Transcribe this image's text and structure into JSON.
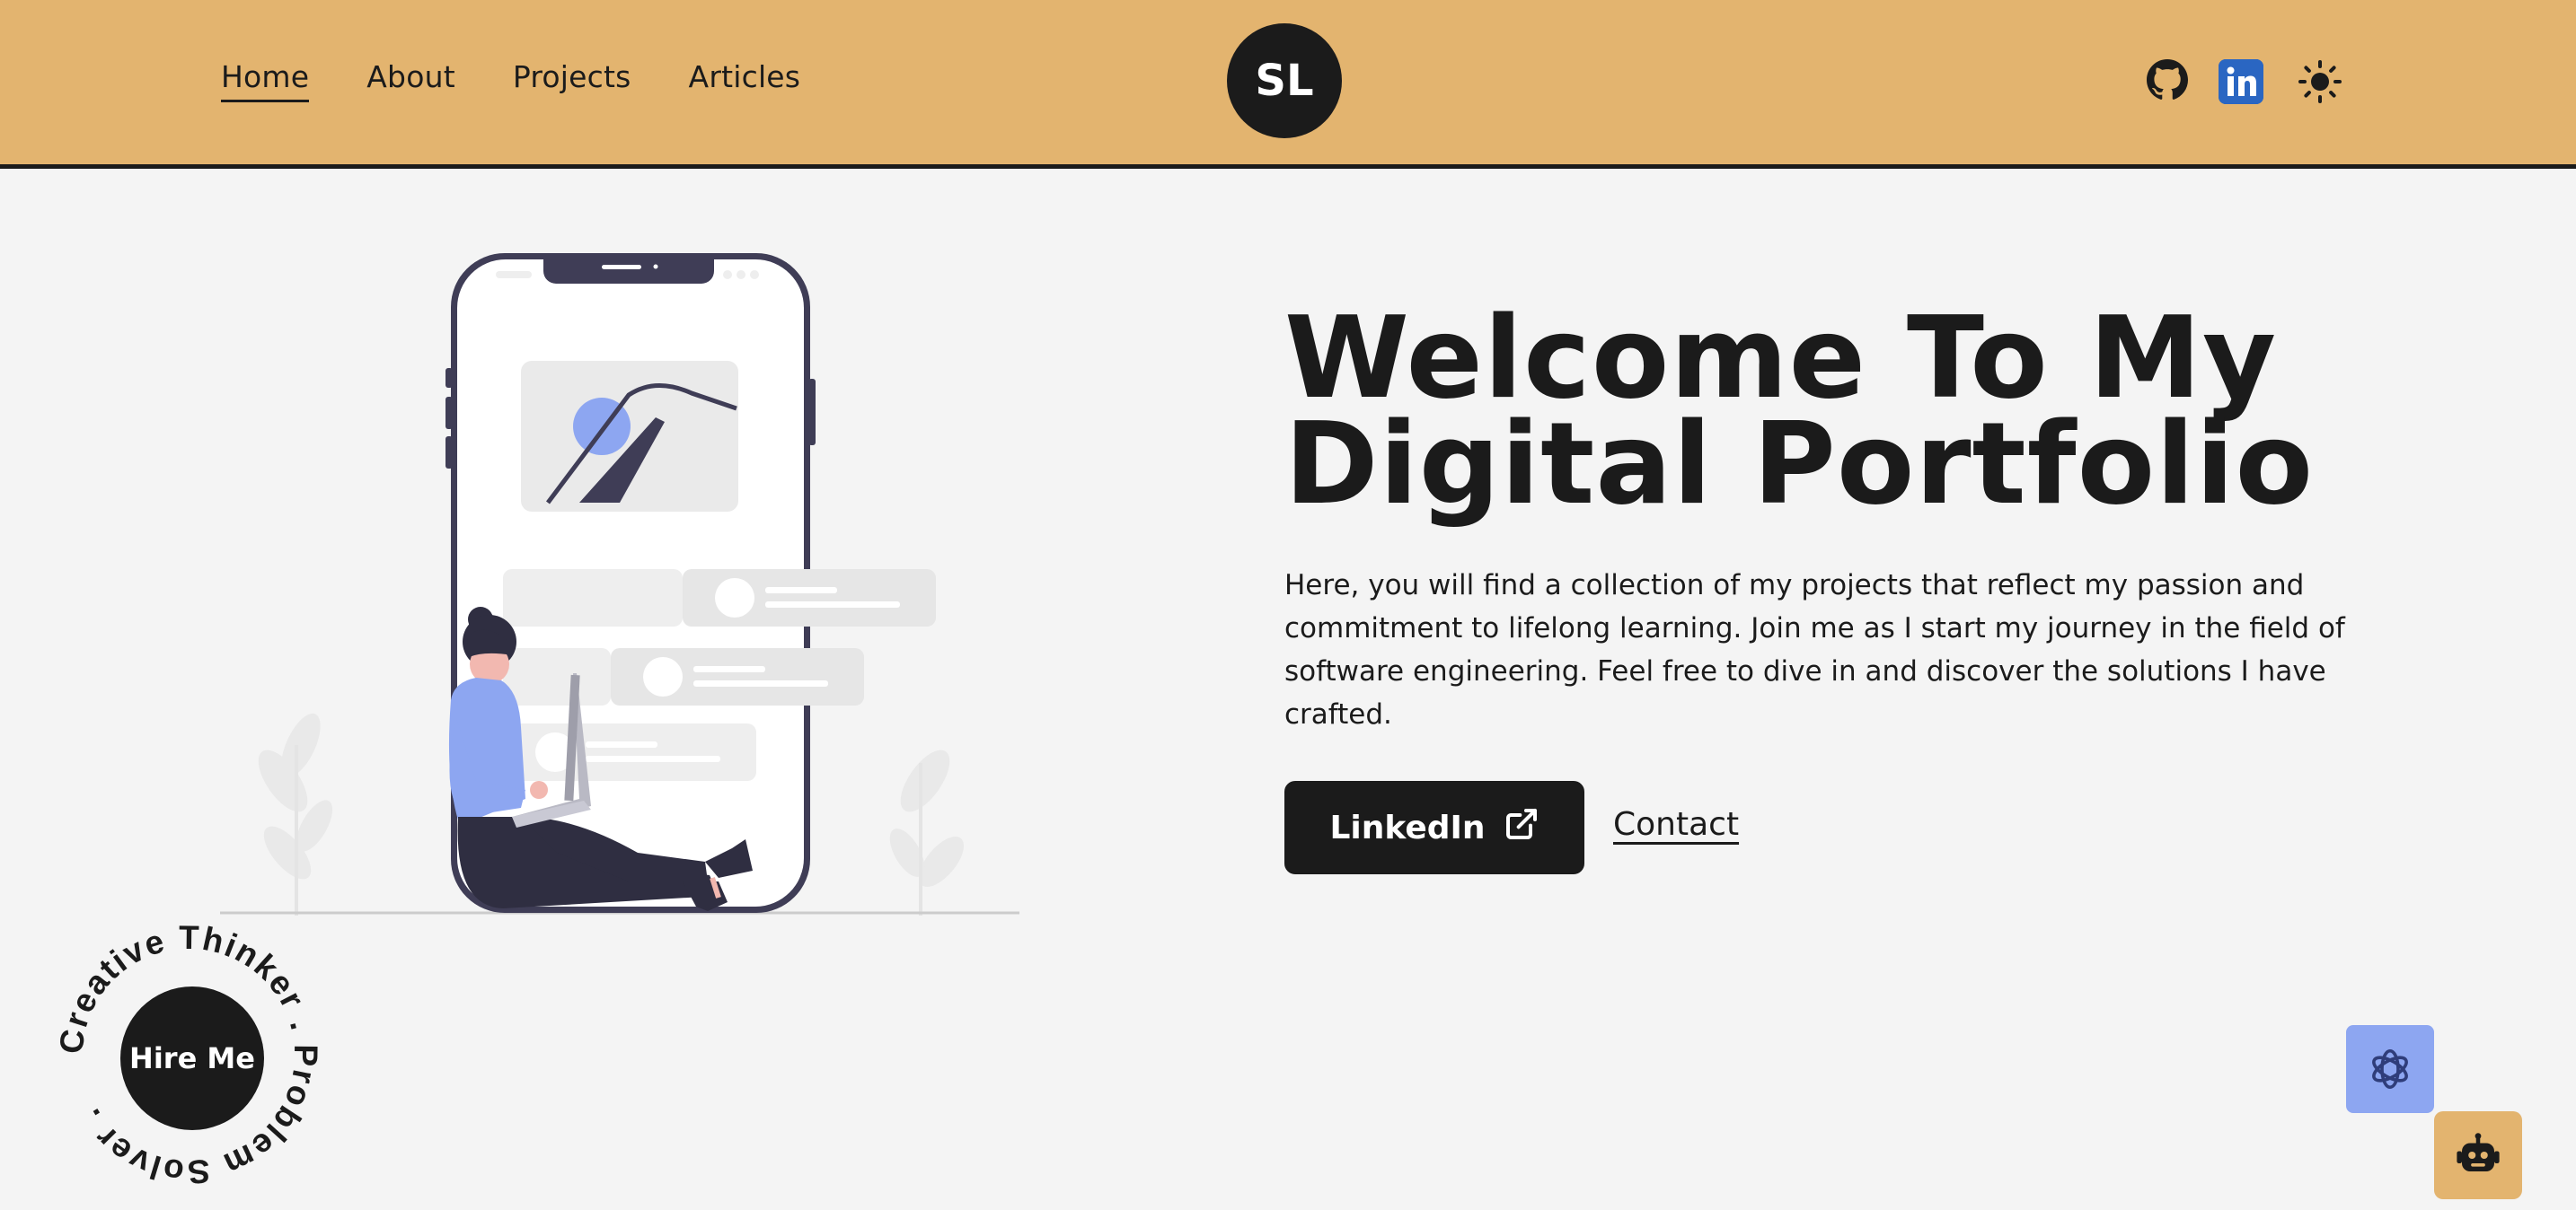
{
  "nav": {
    "items": [
      {
        "label": "Home"
      },
      {
        "label": "About"
      },
      {
        "label": "Projects"
      },
      {
        "label": "Articles"
      }
    ],
    "logo_text": "SL",
    "icons": [
      "github-icon",
      "linkedin-icon",
      "sun-icon"
    ]
  },
  "hero": {
    "title_line1": "Welcome To My",
    "title_line2": "Digital Portfolio",
    "description": "Here, you will find a collection of my projects that reflect my passion and commitment to lifelong learning. Join me as I start my journey in the field of software engineering. Feel free to dive in and discover the solutions I have crafted.",
    "linkedin_label": "LinkedIn",
    "contact_label": "Contact"
  },
  "hire": {
    "label": "Hire Me",
    "ring_text": "Creative Thinker . Problem Solver . "
  },
  "colors": {
    "header_bg": "#e3b46f",
    "page_bg": "#f4f4f4",
    "dark": "#1b1b1b",
    "accent_blue": "#8da6f1",
    "linkedin_blue": "#2a66c2"
  }
}
